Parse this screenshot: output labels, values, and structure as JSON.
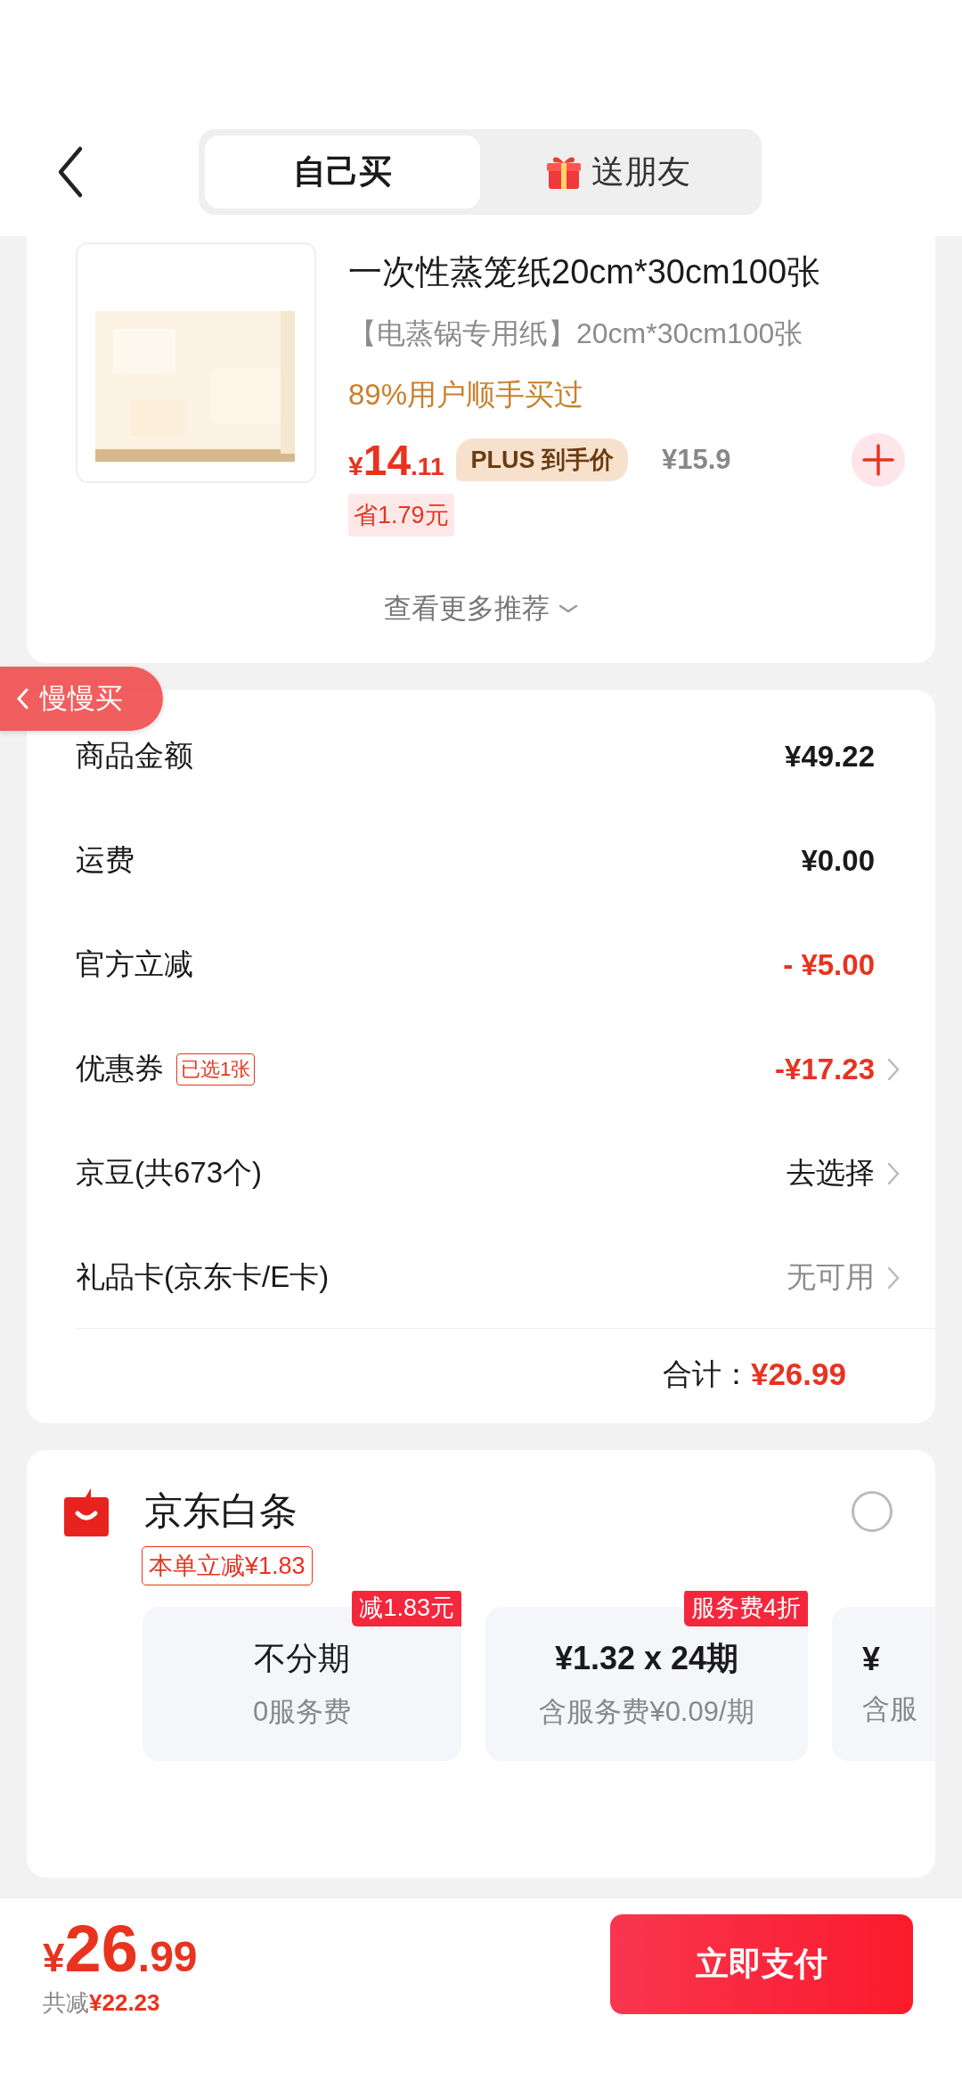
{
  "header": {
    "tabs": [
      {
        "label": "自己买",
        "selected": true,
        "kind": "plain"
      },
      {
        "label": "送朋友",
        "selected": false,
        "kind": "gift"
      }
    ]
  },
  "product": {
    "title": "一次性蒸笼纸20cm*30cm100张",
    "spec": "【电蒸锅专用纸】20cm*30cm100张",
    "social_proof": "89%用户顺手买过",
    "price_symbol": "¥",
    "price_int": "14",
    "price_dec": ".11",
    "plus_badge": "PLUS 到手价",
    "original_price": "¥15.9",
    "saving": "省1.79元"
  },
  "more_link": "查看更多推荐",
  "floating_tab": {
    "label": "慢慢买"
  },
  "summary": {
    "rows": [
      {
        "label": "商品金额",
        "value": "¥49.22",
        "kind": "strong",
        "arrow": false
      },
      {
        "label": "运费",
        "value": "¥0.00",
        "kind": "strong",
        "arrow": false
      },
      {
        "label": "官方立减",
        "value": "- ¥5.00",
        "kind": "red",
        "arrow": false
      },
      {
        "label": "优惠券",
        "tag": "已选1张",
        "value": "-¥17.23",
        "kind": "red",
        "arrow": true
      },
      {
        "label": "京豆(共673个)",
        "value": "去选择",
        "kind": "normal",
        "arrow": true
      },
      {
        "label": "礼品卡(京东卡/E卡)",
        "value": "无可用",
        "kind": "muted",
        "arrow": true
      }
    ],
    "total_label": "合计：",
    "total_value": "¥26.99"
  },
  "payment": {
    "name": "京东白条",
    "selected": false,
    "promo": "本单立减¥1.83",
    "plans": [
      {
        "title": "不分期",
        "fee": "0服务费",
        "badge": "减1.83元"
      },
      {
        "title": "¥1.32 x 24期",
        "fee": "含服务费¥0.09/期",
        "badge": "服务费4折"
      },
      {
        "title": "¥",
        "fee": "含服"
      }
    ]
  },
  "footer": {
    "price_symbol": "¥",
    "price_int": "26",
    "price_dec": ".99",
    "saved_label": "共减",
    "saved_value": "¥22.23",
    "button": "立即支付"
  }
}
